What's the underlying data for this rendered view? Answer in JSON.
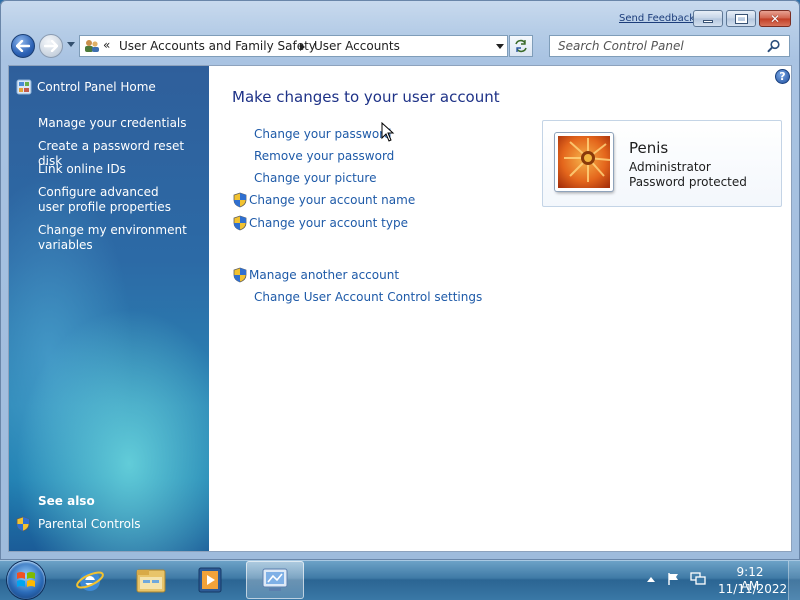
{
  "title_bar": {
    "send_feedback": "Send Feedback",
    "minimize_icon": "minimize-icon",
    "maximize_icon": "maximize-icon",
    "close_icon": "close-icon"
  },
  "address_bar": {
    "overflow_chevron": "«",
    "crumbs": [
      "User Accounts and Family Safety",
      "User Accounts"
    ]
  },
  "search": {
    "placeholder": "Search Control Panel"
  },
  "left_pane": {
    "home_label": "Control Panel Home",
    "links": [
      "Manage your credentials",
      "Create a password reset disk",
      "Link online IDs",
      "Configure advanced user profile properties",
      "Change my environment variables"
    ],
    "see_also_heading": "See also",
    "see_also_links": [
      "Parental Controls"
    ]
  },
  "main": {
    "title": "Make changes to your user account",
    "tasks": {
      "change_password": "Change your password",
      "remove_password": "Remove your password",
      "change_picture": "Change your picture",
      "change_account_name": "Change your account name",
      "change_account_type": "Change your account type",
      "manage_another": "Manage another account",
      "uac_settings": "Change User Account Control settings"
    },
    "help_glyph": "?"
  },
  "account": {
    "name": "Penis",
    "role": "Administrator",
    "status": "Password protected"
  },
  "taskbar": {
    "pinned": [
      "start-orb",
      "internet-explorer-icon",
      "windows-explorer-icon",
      "media-player-icon",
      "control-panel-icon"
    ],
    "clock_time": "9:12 AM",
    "clock_date": "11/11/2022"
  },
  "colors": {
    "link": "#1e5aa8",
    "title": "#1e3287",
    "left_pane_top": "#2f5f9b",
    "left_pane_glow": "#78e6e6"
  }
}
